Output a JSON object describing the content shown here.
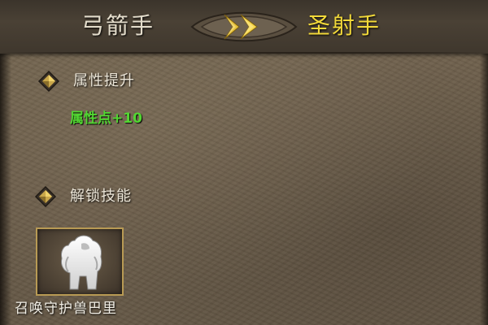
{
  "header": {
    "from_class": "弓箭手",
    "to_class": "圣射手",
    "arrow_icon": "double-chevron-right-icon"
  },
  "sections": {
    "attributes": {
      "title": "属性提升",
      "icon": "diamond-bullet-icon",
      "bonus": "属性点+10"
    },
    "skills": {
      "title": "解锁技能",
      "icon": "diamond-bullet-icon",
      "items": [
        {
          "name": "召唤守护兽巴里",
          "icon": "guardian-beast-icon"
        }
      ]
    }
  },
  "colors": {
    "to_class": "#f2d93a",
    "bonus": "#52d632",
    "slot_border": "#b89a54"
  }
}
